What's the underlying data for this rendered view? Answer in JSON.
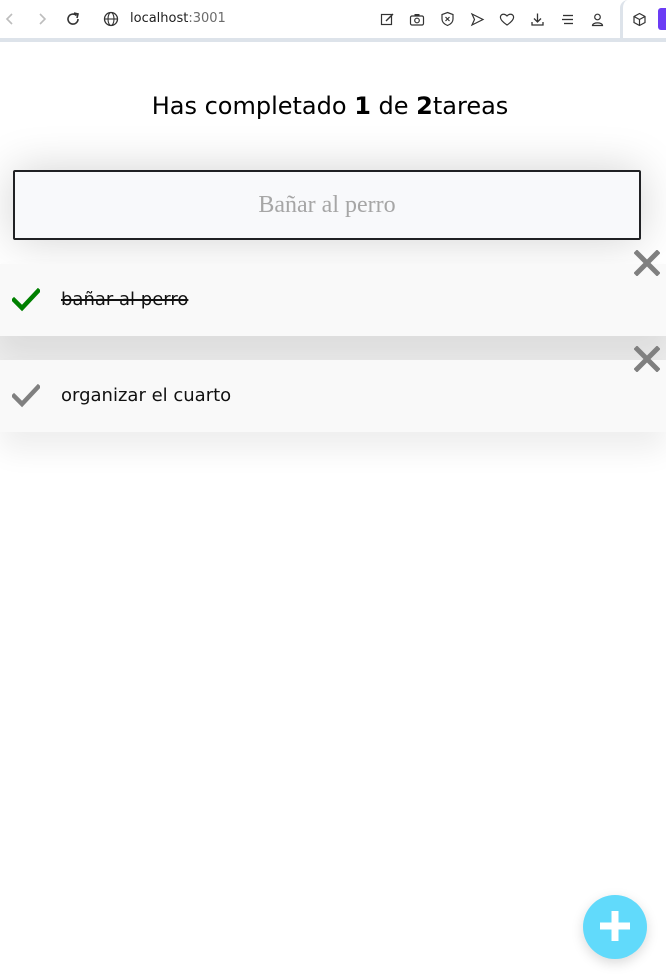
{
  "browser": {
    "url_host": "localhost",
    "url_port": ":3001",
    "icons": [
      "back-icon",
      "forward-icon",
      "reload-icon",
      "globe-icon",
      "edit-page-icon",
      "camera-icon",
      "shield-icon",
      "send-icon",
      "heart-icon",
      "download-icon",
      "menu-icon",
      "account-icon",
      "extension-box-icon"
    ]
  },
  "counter": {
    "prefix": "Has completado ",
    "completed": "1",
    "middle": " de ",
    "total": "2",
    "suffix": "tareas"
  },
  "search": {
    "placeholder": "Bañar al perro",
    "value": ""
  },
  "todos": [
    {
      "text": "bañar al perro",
      "completed": true
    },
    {
      "text": "organizar el cuarto",
      "completed": false
    }
  ],
  "colors": {
    "check_done": "#008000",
    "check_pending": "#808080",
    "delete": "#808080",
    "fab": "#61dafb"
  },
  "fab": {
    "icon": "plus-icon"
  }
}
